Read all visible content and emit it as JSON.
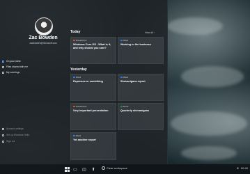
{
  "profile": {
    "name": "Zac Bowden",
    "email": "zacbowden@microsoft.com"
  },
  "nav": {
    "items": [
      {
        "label": "On your mind",
        "active": true
      },
      {
        "label": "Files shared with me"
      },
      {
        "label": "My meetings"
      }
    ],
    "bottom": [
      {
        "label": "Account settings"
      },
      {
        "label": "Set up Windows Hello"
      },
      {
        "label": "Sign out"
      }
    ]
  },
  "feed": {
    "today_label": "Today",
    "yesterday_label": "Yesterday",
    "view_all": "View all",
    "today_cards": [
      {
        "app": "PowerPoint",
        "app_color": "#d35230",
        "title": "Windows Core OS - What is it, and why should you care?",
        "meta": ""
      },
      {
        "app": "Word",
        "app_color": "#2b7cd3",
        "title": "Working in the business",
        "meta": ""
      }
    ],
    "yesterday_cards": [
      {
        "app": "Word",
        "app_color": "#2b7cd3",
        "title": "Expenses or something",
        "meta": ""
      },
      {
        "app": "Word",
        "app_color": "#2b7cd3",
        "title": "Shenanigans report",
        "meta": ""
      },
      {
        "app": "PowerPoint",
        "app_color": "#d35230",
        "title": "Very important presentation",
        "meta": ""
      },
      {
        "app": "Excel",
        "app_color": "#1f8b4c",
        "title": "Quarterly shenanigans",
        "meta": ""
      },
      {
        "app": "Word",
        "app_color": "#2b7cd3",
        "title": "Yet another report",
        "meta": ""
      }
    ]
  },
  "taskbar": {
    "search_text": "Clear workspace",
    "time": "00:49"
  }
}
